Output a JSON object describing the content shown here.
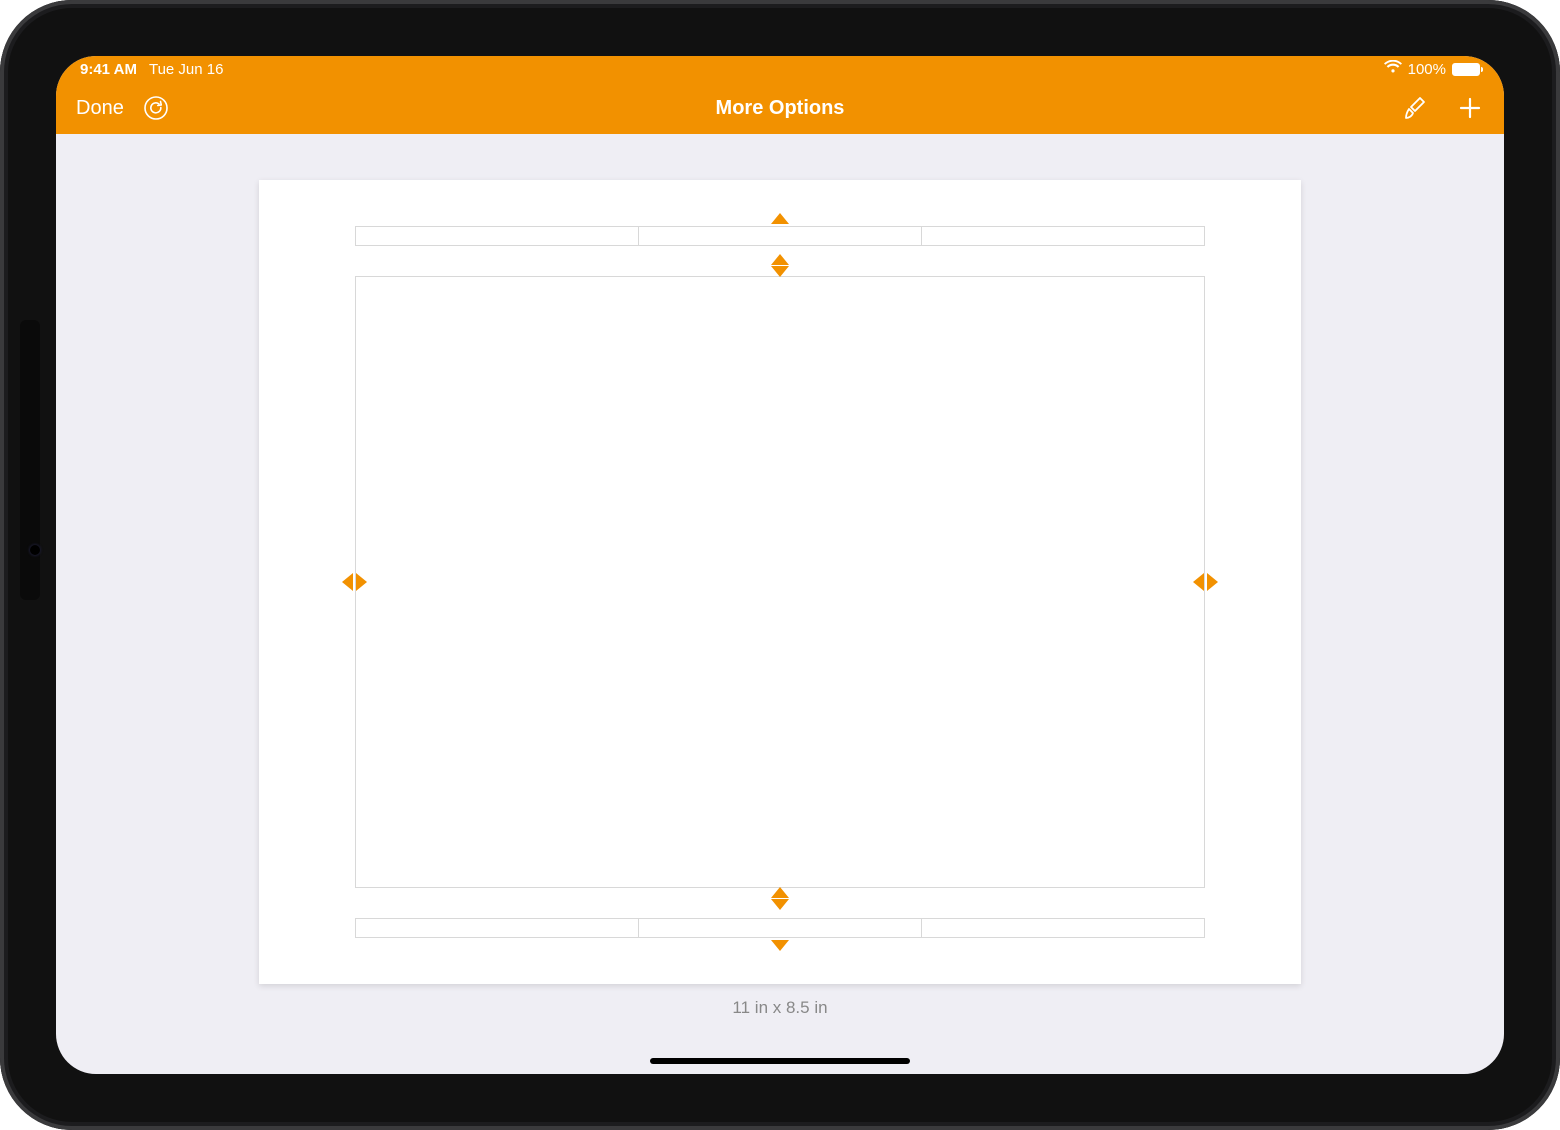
{
  "status": {
    "time": "9:41 AM",
    "date": "Tue Jun 16",
    "battery": "100%"
  },
  "toolbar": {
    "done_label": "Done",
    "title": "More Options"
  },
  "page": {
    "size_label": "11 in x 8.5 in"
  },
  "colors": {
    "accent": "#f29100"
  }
}
